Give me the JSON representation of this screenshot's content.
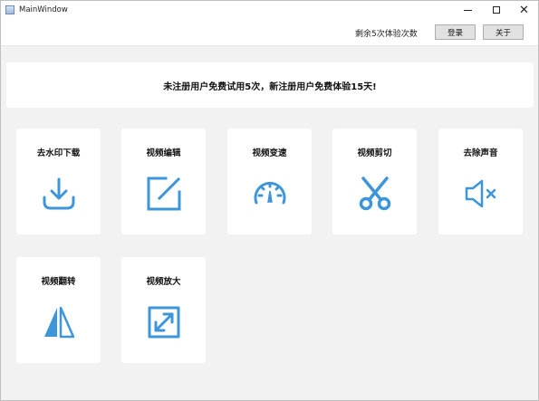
{
  "window": {
    "title": "MainWindow",
    "controls": {
      "minimize": "minimize",
      "maximize": "maximize",
      "close": "✕"
    }
  },
  "header": {
    "remaining_text": "剩余5次体验次数",
    "login_label": "登录",
    "about_label": "关于"
  },
  "notice": {
    "text": "未注册用户免费试用5次，新注册用户免费体验15天!"
  },
  "features": [
    {
      "label": "去水印下载",
      "icon": "download-icon"
    },
    {
      "label": "视频编辑",
      "icon": "edit-icon"
    },
    {
      "label": "视频变速",
      "icon": "speedometer-icon"
    },
    {
      "label": "视频剪切",
      "icon": "scissors-icon"
    },
    {
      "label": "去除声音",
      "icon": "mute-icon"
    },
    {
      "label": "视频翻转",
      "icon": "flip-icon"
    },
    {
      "label": "视频放大",
      "icon": "enlarge-icon"
    }
  ],
  "colors": {
    "accent": "#3d96d9",
    "background": "#f2f2f2",
    "card": "#ffffff"
  }
}
